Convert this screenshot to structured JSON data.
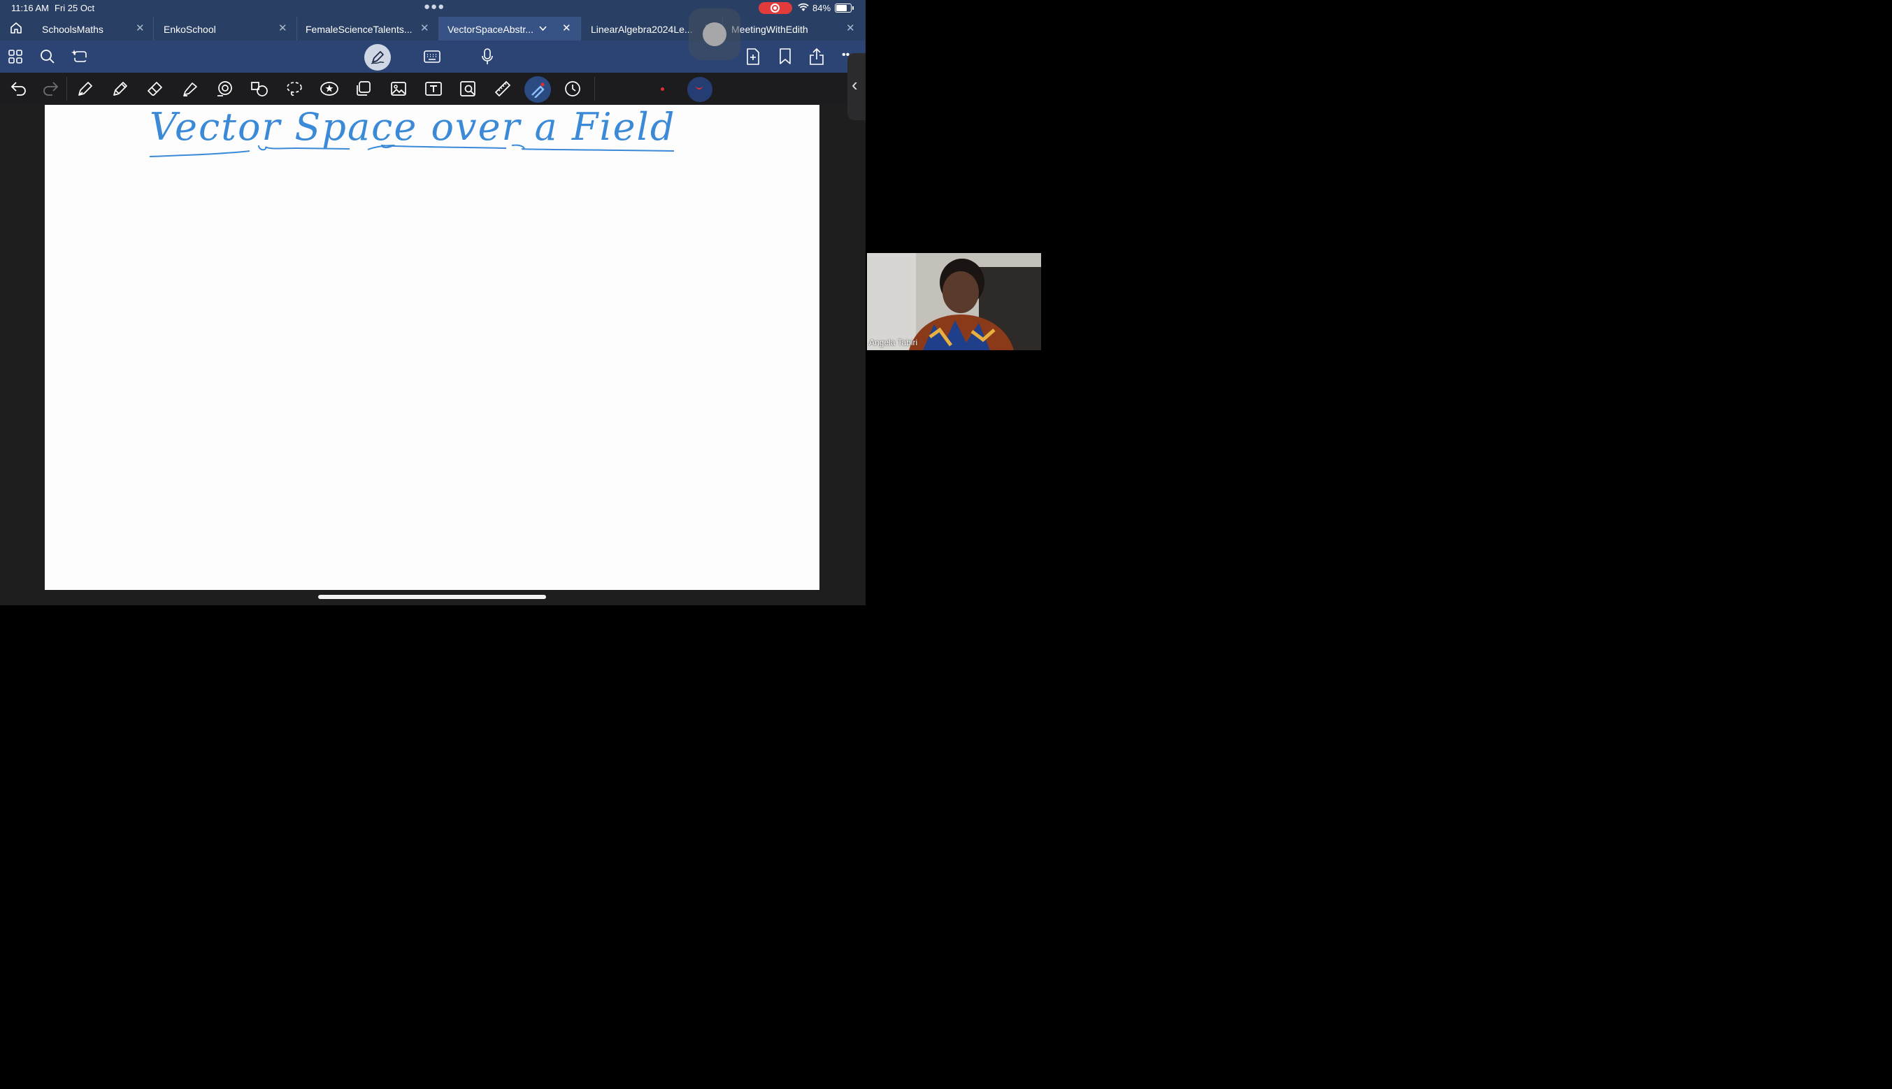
{
  "status_bar": {
    "time": "11:16 AM",
    "date": "Fri 25 Oct",
    "battery": "84%",
    "battery_level": 0.84
  },
  "tabs": [
    {
      "label": "SchoolsMaths",
      "active": false
    },
    {
      "label": "EnkoSchool",
      "active": false
    },
    {
      "label": "FemaleScienceTalents...",
      "active": false
    },
    {
      "label": "VectorSpaceAbstr...",
      "active": true
    },
    {
      "label": "LinearAlgebra2024Le...",
      "active": false
    },
    {
      "label": "MeetingWithEdith",
      "active": false
    }
  ],
  "toolbar_top": {
    "left_icons": [
      "grid-icon",
      "search-icon",
      "lasso-sparkle-icon"
    ],
    "center_icons": [
      "pen-mode-icon",
      "keyboard-icon",
      "microphone-icon"
    ],
    "right_icons": [
      "add-page-icon",
      "bookmark-icon",
      "share-icon",
      "more-icon"
    ]
  },
  "toolbar_tools": [
    "undo-icon",
    "redo-icon",
    "fountain-pen-icon",
    "pencil-icon",
    "eraser-icon",
    "highlighter-icon",
    "shapes-icon",
    "shape-recognition-icon",
    "lasso-icon",
    "sticker-icon",
    "elements-icon",
    "image-icon",
    "text-box-icon",
    "zoom-window-icon",
    "ruler-icon",
    "laser-pointer-icon",
    "history-icon"
  ],
  "colors": {
    "tab_bar": "#2a3f64",
    "active_tab": "#375385",
    "ink": "#3a8ad8",
    "active_color": "#e03030"
  },
  "note": {
    "handwritten_title": "Vector Space over a Field"
  },
  "video": {
    "participant_name": "Angela Tabiri"
  }
}
